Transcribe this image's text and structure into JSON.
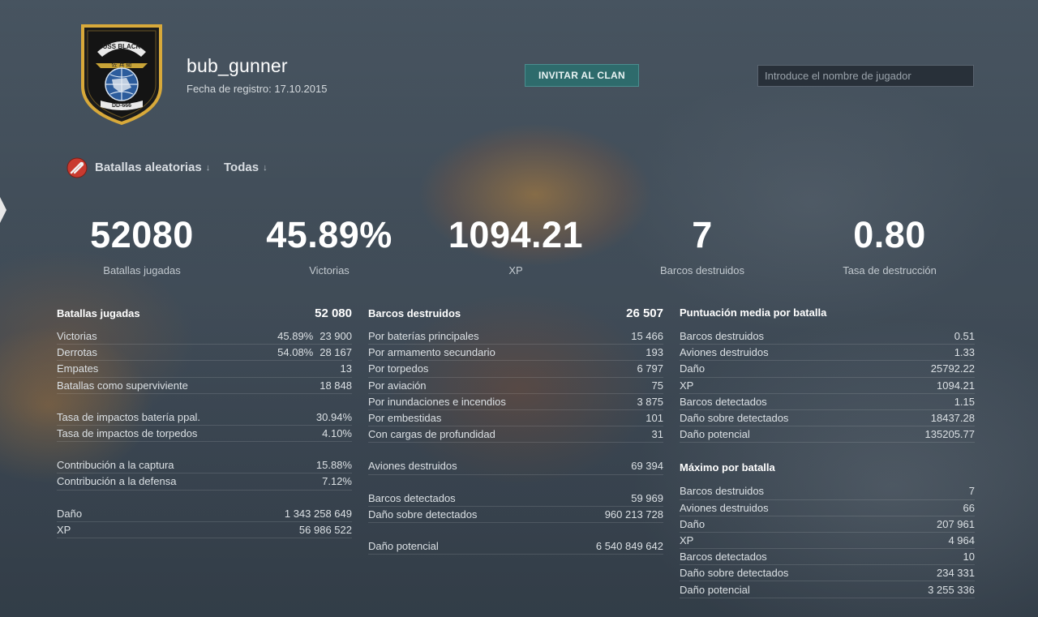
{
  "player": {
    "name": "bub_gunner",
    "registration": "Fecha de registro: 17.10.2015",
    "emblem_text_top": "USS BLACK",
    "emblem_text_bottom": "DD-666"
  },
  "header": {
    "invite_label": "INVITAR AL CLAN",
    "search_placeholder": "Introduce el nombre de jugador"
  },
  "filters": {
    "mode_label": "Batallas aleatorias",
    "type_label": "Todas",
    "arrow": "↓"
  },
  "summary": [
    {
      "value": "52080",
      "label": "Batallas jugadas"
    },
    {
      "value": "45.89%",
      "label": "Victorias"
    },
    {
      "value": "1094.21",
      "label": "XP"
    },
    {
      "value": "7",
      "label": "Barcos destruidos"
    },
    {
      "value": "0.80",
      "label": "Tasa de destrucción"
    }
  ],
  "battles": {
    "title": "Batallas jugadas",
    "total": "52 080",
    "rows": [
      {
        "label": "Victorias",
        "pct": "45.89%",
        "value": "23 900"
      },
      {
        "label": "Derrotas",
        "pct": "54.08%",
        "value": "28 167"
      },
      {
        "label": "Empates",
        "value": "13"
      },
      {
        "label": "Batallas como superviviente",
        "value": "18 848"
      }
    ],
    "rows2": [
      {
        "label": "Tasa de impactos batería ppal.",
        "value": "30.94%"
      },
      {
        "label": "Tasa de impactos de torpedos",
        "value": "4.10%"
      }
    ],
    "rows3": [
      {
        "label": "Contribución a la captura",
        "value": "15.88%"
      },
      {
        "label": "Contribución a la defensa",
        "value": "7.12%"
      }
    ],
    "rows4": [
      {
        "label": "Daño",
        "value": "1 343 258 649"
      },
      {
        "label": "XP",
        "value": "56 986 522"
      }
    ]
  },
  "kills": {
    "title": "Barcos destruidos",
    "total": "26 507",
    "rows": [
      {
        "label": "Por baterías principales",
        "value": "15 466"
      },
      {
        "label": "Por armamento secundario",
        "value": "193"
      },
      {
        "label": "Por torpedos",
        "value": "6 797"
      },
      {
        "label": "Por aviación",
        "value": "75"
      },
      {
        "label": "Por inundaciones e incendios",
        "value": "3 875"
      },
      {
        "label": "Por embestidas",
        "value": "101"
      },
      {
        "label": "Con cargas de profundidad",
        "value": "31"
      }
    ],
    "rows2": [
      {
        "label": "Aviones destruidos",
        "value": "69 394"
      }
    ],
    "rows3": [
      {
        "label": "Barcos detectados",
        "value": "59 969"
      },
      {
        "label": "Daño sobre detectados",
        "value": "960 213 728"
      }
    ],
    "rows4": [
      {
        "label": "Daño potencial",
        "value": "6 540 849 642"
      }
    ]
  },
  "average": {
    "title": "Puntuación media por batalla",
    "rows": [
      {
        "label": "Barcos destruidos",
        "value": "0.51"
      },
      {
        "label": "Aviones destruidos",
        "value": "1.33"
      },
      {
        "label": "Daño",
        "value": "25792.22"
      },
      {
        "label": "XP",
        "value": "1094.21"
      },
      {
        "label": "Barcos detectados",
        "value": "1.15"
      },
      {
        "label": "Daño sobre detectados",
        "value": "18437.28"
      },
      {
        "label": "Daño potencial",
        "value": "135205.77"
      }
    ]
  },
  "maximum": {
    "title": "Máximo por batalla",
    "rows": [
      {
        "label": "Barcos destruidos",
        "value": "7"
      },
      {
        "label": "Aviones destruidos",
        "value": "66"
      },
      {
        "label": "Daño",
        "value": "207 961"
      },
      {
        "label": "XP",
        "value": "4 964"
      },
      {
        "label": "Barcos detectados",
        "value": "10"
      },
      {
        "label": "Daño sobre detectados",
        "value": "234 331"
      },
      {
        "label": "Daño potencial",
        "value": "3 255 336"
      }
    ]
  },
  "colors": {
    "accent_button": "#2e6b6c",
    "text_primary": "#ffffff",
    "text_secondary": "#c2c9cf"
  }
}
